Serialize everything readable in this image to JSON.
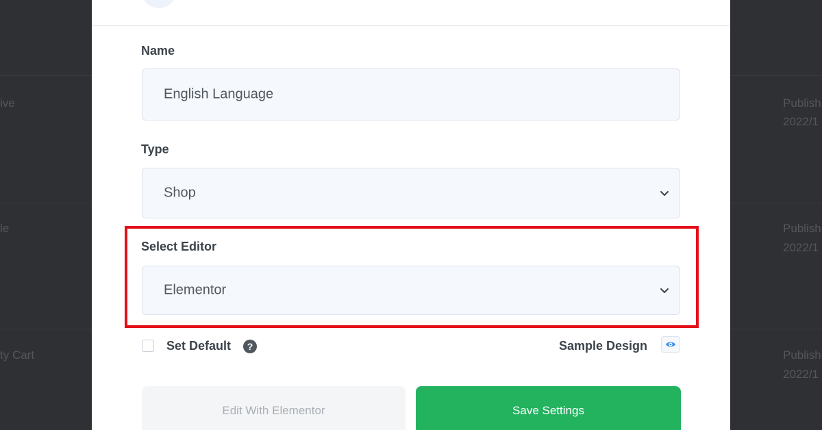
{
  "background": {
    "left_items": [
      {
        "text": "ive"
      },
      {
        "text": "le"
      },
      {
        "text": "ty Cart"
      }
    ],
    "right_items": [
      {
        "status": "Publish",
        "date": "2022/1"
      },
      {
        "status": "Publish",
        "date": "2022/1"
      },
      {
        "status": "Publish",
        "date": "2022/1"
      }
    ]
  },
  "form": {
    "name": {
      "label": "Name",
      "value": "English Language"
    },
    "type": {
      "label": "Type",
      "value": "Shop"
    },
    "editor": {
      "label": "Select Editor",
      "value": "Elementor"
    },
    "set_default": {
      "label": "Set Default",
      "checked": false,
      "help_icon": "?"
    },
    "sample_design": {
      "label": "Sample Design",
      "icon": "eye-icon"
    }
  },
  "buttons": {
    "edit_label": "Edit With Elementor",
    "save_label": "Save Settings"
  },
  "colors": {
    "accent_green": "#23b35f",
    "highlight_red": "#e3101a",
    "eye_blue": "#3b8fe8"
  }
}
